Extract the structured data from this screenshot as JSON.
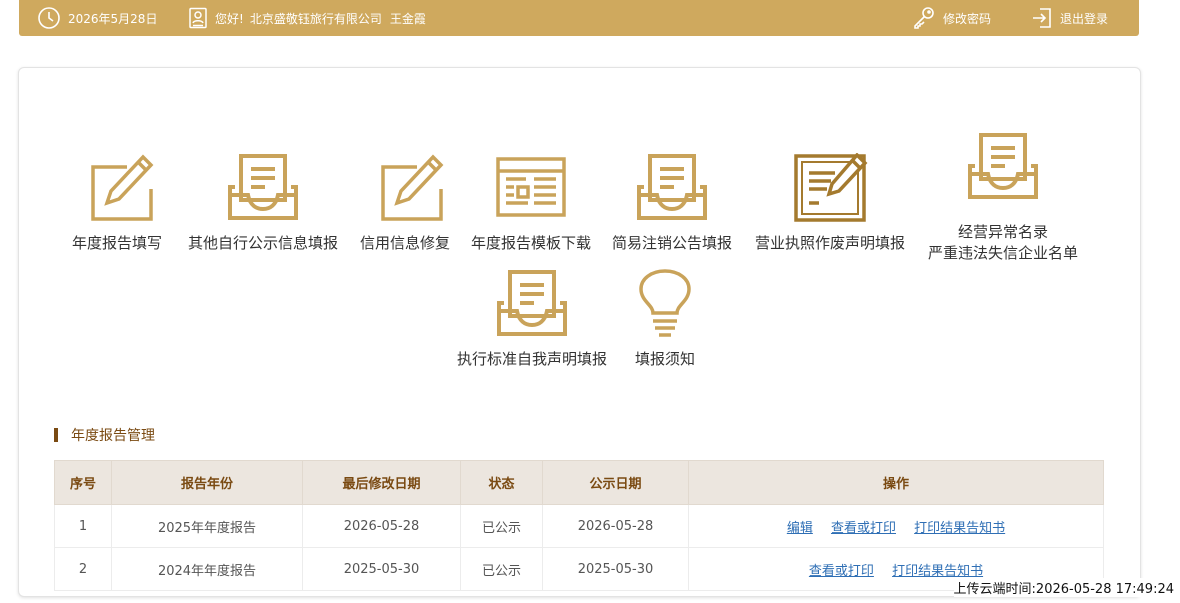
{
  "header": {
    "date": "2026年5月28日",
    "greeting": "您好!",
    "company": "北京盛敬钰旅行有限公司",
    "user": "王金霞",
    "change_password": "修改密码",
    "logout": "退出登录"
  },
  "tiles": [
    {
      "label": "年度报告填写",
      "icon": "edit-document-icon"
    },
    {
      "label": "其他自行公示信息填报",
      "icon": "inbox-tray-icon"
    },
    {
      "label": "信用信息修复",
      "icon": "edit-document-icon"
    },
    {
      "label": "年度报告模板下载",
      "icon": "template-icon"
    },
    {
      "label": "简易注销公告填报",
      "icon": "inbox-tray-icon"
    },
    {
      "label": "营业执照作废声明填报",
      "icon": "certificate-edit-icon"
    },
    {
      "label_line1": "经营异常名录",
      "label_line2": "严重违法失信企业名单",
      "icon": "inbox-tray-icon"
    },
    {
      "label": "执行标准自我声明填报",
      "icon": "inbox-tray-icon"
    },
    {
      "label": "填报须知",
      "icon": "lightbulb-icon"
    }
  ],
  "section": {
    "title": "年度报告管理"
  },
  "table": {
    "headers": [
      "序号",
      "报告年份",
      "最后修改日期",
      "状态",
      "公示日期",
      "操作"
    ],
    "rows": [
      {
        "no": "1",
        "year": "2025年年度报告",
        "modified": "2026-05-28",
        "status": "已公示",
        "published": "2026-05-28",
        "actions": [
          "编辑",
          "查看或打印",
          "打印结果告知书"
        ]
      },
      {
        "no": "2",
        "year": "2024年年度报告",
        "modified": "2025-05-30",
        "status": "已公示",
        "published": "2025-05-30",
        "actions": [
          "查看或打印",
          "打印结果告知书"
        ]
      }
    ]
  },
  "footer": {
    "upload_time": "上传云端时间:2026-05-28 17:49:24"
  },
  "colors": {
    "brand": "#cfa95e",
    "icon_gold": "#c9a35a",
    "icon_dark": "#a47a2e",
    "link": "#2f6fb5",
    "title_brown": "#7a4a12"
  }
}
